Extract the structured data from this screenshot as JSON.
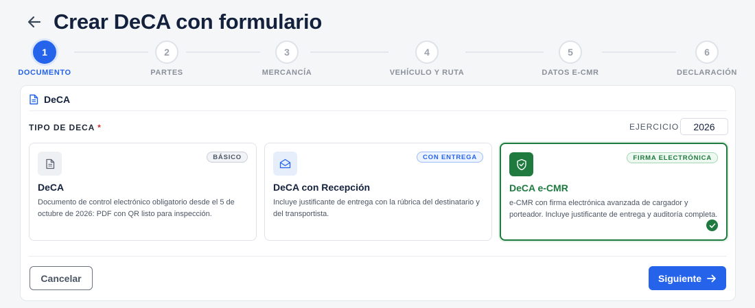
{
  "page": {
    "title": "Crear DeCA con formulario"
  },
  "steps": [
    {
      "number": "1",
      "label": "DOCUMENTO",
      "active": true
    },
    {
      "number": "2",
      "label": "PARTES",
      "active": false
    },
    {
      "number": "3",
      "label": "MERCANCÍA",
      "active": false
    },
    {
      "number": "4",
      "label": "VEHÍCULO Y RUTA",
      "active": false
    },
    {
      "number": "5",
      "label": "DATOS E-CMR",
      "active": false
    },
    {
      "number": "6",
      "label": "DECLARACIÓN",
      "active": false
    }
  ],
  "card": {
    "title": "DeCA",
    "type_label": "TIPO DE DECA",
    "required_mark": "*",
    "year_label": "EJERCICIO",
    "year_value": "2026"
  },
  "options": [
    {
      "badge": "BÁSICO",
      "title": "DeCA",
      "description": "Documento de control electrónico obligatorio desde el 5 de octubre de 2026: PDF con QR listo para inspección.",
      "icon": "document-icon",
      "selected": false
    },
    {
      "badge": "CON ENTREGA",
      "title": "DeCA con Recepción",
      "description": "Incluye justificante de entrega con la rúbrica del destinatario y del transportista.",
      "icon": "envelope-open-icon",
      "selected": false
    },
    {
      "badge": "FIRMA ELECTRÓNICA",
      "title": "DeCA e-CMR",
      "description": "e-CMR con firma electrónica avanzada de cargador y porteador. Incluye justificante de entrega y auditoría completa.",
      "icon": "shield-check-icon",
      "selected": true
    }
  ],
  "actions": {
    "cancel": "Cancelar",
    "next": "Siguiente"
  },
  "colors": {
    "primary": "#2563eb",
    "success": "#1e7a3e",
    "title": "#14213d"
  }
}
